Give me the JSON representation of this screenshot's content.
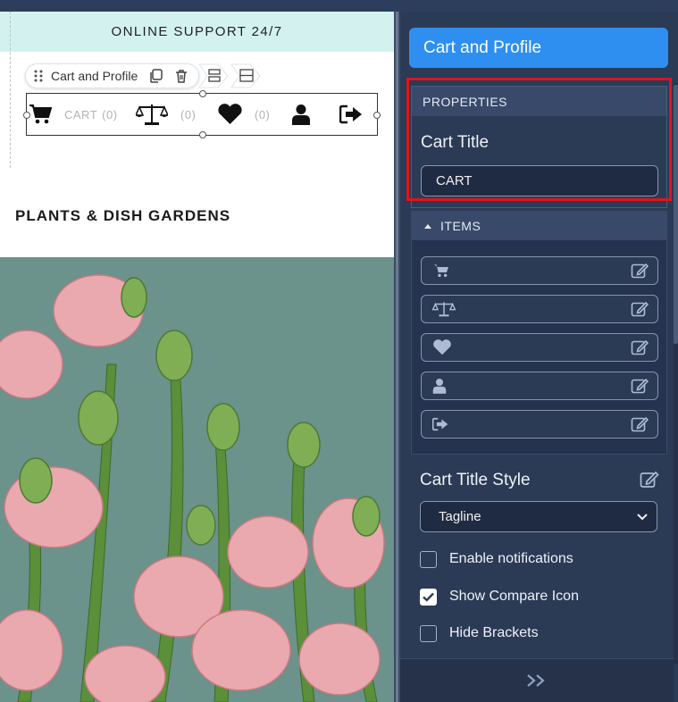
{
  "canvas": {
    "support_text": "ONLINE SUPPORT 24/7",
    "widget_toolbar": {
      "title": "Cart and Profile"
    },
    "cart_widget": {
      "cart_label": "CART",
      "cart_count": "(0)",
      "compare_count": "(0)",
      "wishlist_count": "(0)"
    },
    "section_title": "PLANTS & DISH GARDENS"
  },
  "panel": {
    "header_title": "Cart and Profile",
    "properties_label": "PROPERTIES",
    "cart_title_label": "Cart Title",
    "cart_title_value": "CART",
    "items_label": "ITEMS",
    "items": [
      {
        "icon": "cart-icon"
      },
      {
        "icon": "compare-scale-icon"
      },
      {
        "icon": "heart-icon"
      },
      {
        "icon": "user-icon"
      },
      {
        "icon": "sign-out-icon"
      }
    ],
    "cart_title_style_label": "Cart Title Style",
    "cart_title_style_value": "Tagline",
    "checkboxes": [
      {
        "label": "Enable notifications",
        "checked": false
      },
      {
        "label": "Show Compare Icon",
        "checked": true
      },
      {
        "label": "Hide Brackets",
        "checked": false
      }
    ],
    "footer_icon": "double-chevron-right-icon"
  },
  "colors": {
    "panel_bg": "#2b3a55",
    "header_blue": "#2e8ff0",
    "highlight_red": "#e0141b",
    "support_bar": "#d3f2ef"
  }
}
